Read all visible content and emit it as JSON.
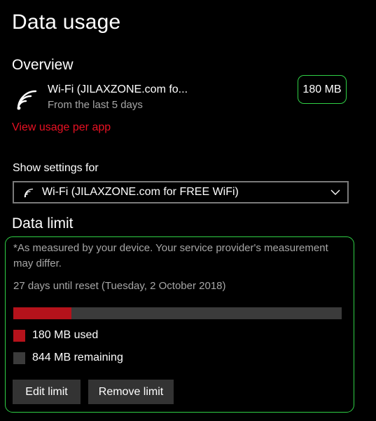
{
  "page": {
    "title": "Data usage"
  },
  "overview": {
    "heading": "Overview",
    "network_icon": "wifi-icon",
    "network_name": "Wi-Fi (JILAXZONE.com fo...",
    "period": "From the last 5 days",
    "total_usage": "180 MB",
    "view_usage_link": "View usage per app"
  },
  "show_settings": {
    "label": "Show settings for",
    "selected_value": "Wi-Fi (JILAXZONE.com for FREE WiFi)",
    "icon": "wifi-icon",
    "chevron_icon": "chevron-down-icon"
  },
  "data_limit": {
    "heading": "Data limit",
    "note": "*As measured by your device. Your service provider's measurement may differ.",
    "reset_info": "27 days until reset (Tuesday, 2 October 2018)",
    "used_fraction": 0.176,
    "used_label": "180 MB used",
    "remaining_label": "844 MB remaining",
    "edit_button": "Edit limit",
    "remove_button": "Remove limit"
  },
  "colors": {
    "background": "#000000",
    "accent_red": "#e81123",
    "used_bar": "#b5121b",
    "remaining_bar": "#3b3b3b",
    "highlight_border": "#2fcf45",
    "secondary_text": "#a6a6a6",
    "button_bg": "#333333"
  }
}
